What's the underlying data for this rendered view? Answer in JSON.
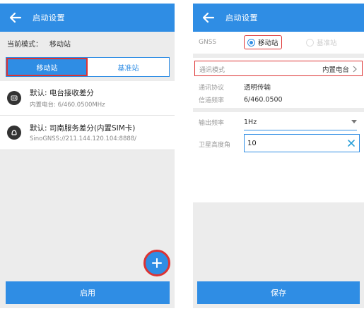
{
  "left": {
    "title": "启动设置",
    "mode_label": "当前模式：",
    "mode_value": "移动站",
    "tabs": [
      "移动站",
      "基准站"
    ],
    "items": [
      {
        "title": "默认: 电台接收差分",
        "subtitle": "内置电台: 6/460.0500MHz",
        "icon": "radio-icon"
      },
      {
        "title": "默认: 司南服务差分(内置SIM卡)",
        "subtitle": "SinoGNSS://211.144.120.104:8888/",
        "icon": "sim-network-icon"
      }
    ],
    "fab": "+",
    "button": "启用"
  },
  "right": {
    "title": "启动设置",
    "gnss_label": "GNSS",
    "gnss_options": [
      "移动站",
      "基准站"
    ],
    "comm_mode_label": "通讯模式",
    "comm_mode_value": "内置电台",
    "protocol_label": "通讯协议",
    "protocol_value": "透明传输",
    "channel_label": "信道频率",
    "channel_value": "6/460.0500",
    "output_freq_label": "输出频率",
    "output_freq_value": "1Hz",
    "elevation_label": "卫星高度角",
    "elevation_value": "10",
    "button": "保存"
  },
  "colors": {
    "accent": "#2f8de4",
    "highlight": "#dd3333",
    "background": "#ececec"
  }
}
